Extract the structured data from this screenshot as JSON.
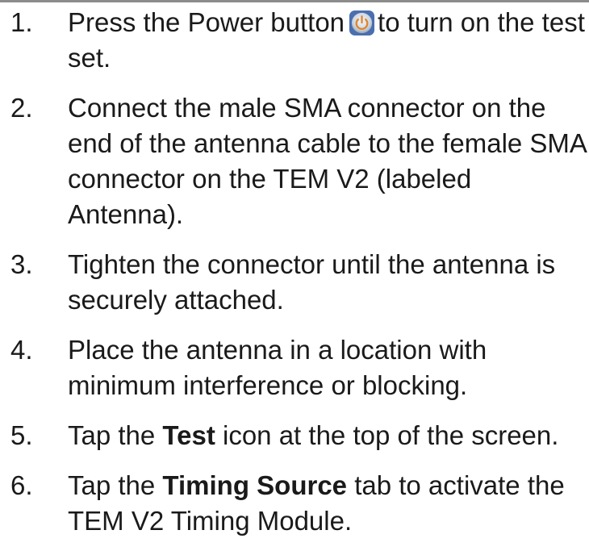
{
  "steps": [
    {
      "number": "1.",
      "text_before_icon": "Press the Power button",
      "icon": "power-icon",
      "text_after_icon": "to turn on the test set."
    },
    {
      "number": "2.",
      "text": "Connect the male SMA connector on the end of the antenna cable to the female SMA connector on the TEM V2 (labeled Antenna)."
    },
    {
      "number": "3.",
      "text": "Tighten the connector until the antenna is securely attached."
    },
    {
      "number": "4.",
      "text": "Place the antenna in a location with minimum interference or blocking."
    },
    {
      "number": "5.",
      "text_before": "Tap the",
      "bold": "Test",
      "text_after": "icon at the top of the screen."
    },
    {
      "number": "6.",
      "text_before": "Tap the",
      "bold": "Timing Source",
      "text_after": "tab to activate the TEM V2 Timing Module."
    }
  ]
}
